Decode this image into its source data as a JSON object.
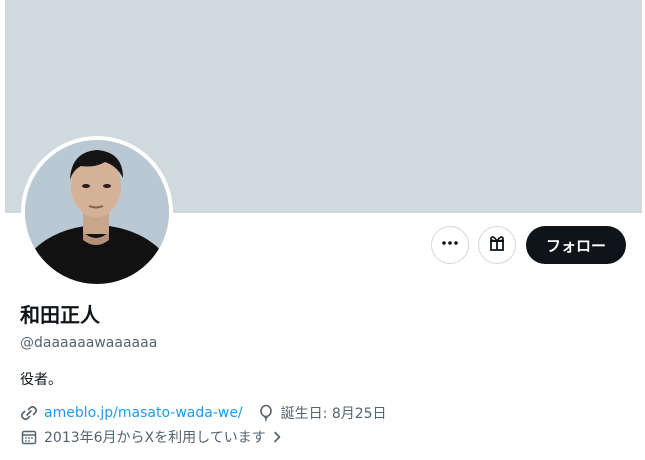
{
  "profile": {
    "display_name": "和田正人",
    "handle": "@daaaaaawaaaaaa",
    "bio": "役者。",
    "website": "ameblo.jp/masato-wada-we/",
    "birthday": "誕生日: 8月25日",
    "joined": "2013年6月からXを利用しています"
  },
  "actions": {
    "follow_label": "フォロー",
    "more_icon": "more-icon",
    "gift_icon": "gift-icon"
  },
  "icons": {
    "link": "link-icon",
    "birthday": "balloon-icon",
    "joined": "calendar-icon",
    "chevron": "chevron-right-icon"
  },
  "colors": {
    "banner": "#cfd9de",
    "link": "#1d9bf0",
    "secondary_text": "#536471",
    "primary_text": "#0f1419",
    "follow_button": "#0f1419"
  }
}
